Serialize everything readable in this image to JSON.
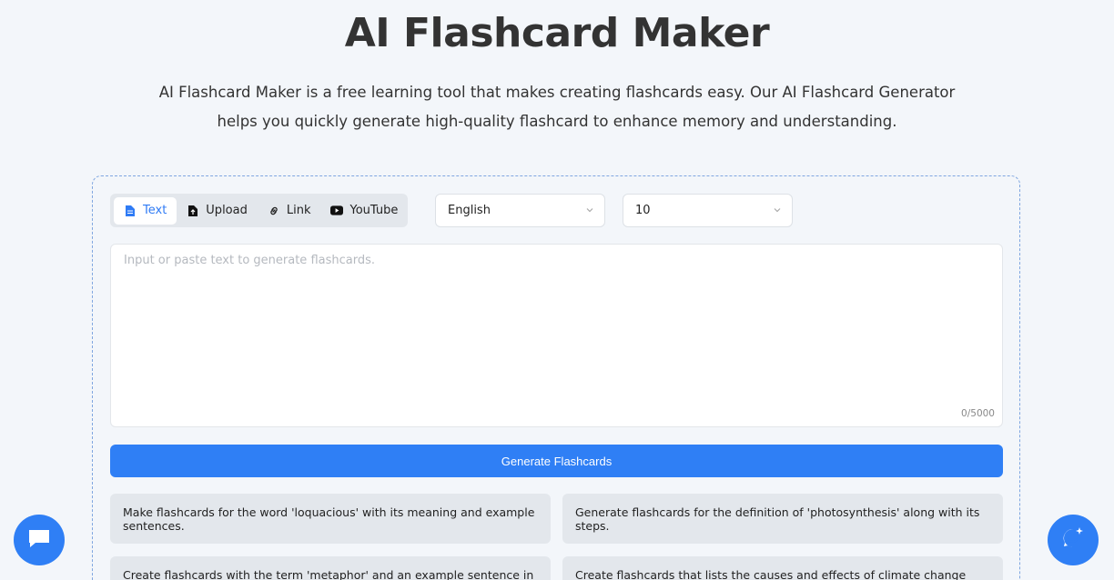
{
  "header": {
    "title": "AI Flashcard Maker",
    "subtitle": "AI Flashcard Maker is a free learning tool that makes creating flashcards easy. Our AI Flashcard Generator helps you quickly generate high-quality flashcard to enhance memory and understanding."
  },
  "tabs": [
    {
      "label": "Text",
      "icon": "document-icon",
      "active": true
    },
    {
      "label": "Upload",
      "icon": "upload-file-icon",
      "active": false
    },
    {
      "label": "Link",
      "icon": "link-icon",
      "active": false
    },
    {
      "label": "YouTube",
      "icon": "youtube-icon",
      "active": false
    }
  ],
  "language_select": {
    "value": "English"
  },
  "count_select": {
    "value": "10"
  },
  "input": {
    "placeholder": "Input or paste text to generate flashcards.",
    "value": "",
    "counter": "0/5000"
  },
  "generate_button": {
    "label": "Generate Flashcards"
  },
  "examples": [
    "Make flashcards for the word 'loquacious' with its meaning and example sentences.",
    "Generate flashcards for the definition of 'photosynthesis' along with its steps.",
    "Create flashcards with the term 'metaphor' and an example sentence in",
    "Create flashcards that lists the causes and effects of climate change"
  ],
  "colors": {
    "accent": "#2f7ff5",
    "background": "#f3f6fa"
  }
}
